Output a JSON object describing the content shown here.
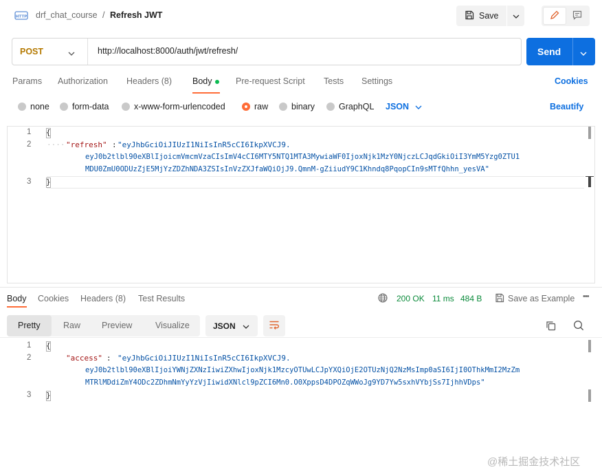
{
  "breadcrumb": {
    "collection": "drf_chat_course",
    "separator": "/",
    "title": "Refresh JWT"
  },
  "toolbar": {
    "save_label": "Save"
  },
  "request": {
    "method": "POST",
    "url": "http://localhost:8000/auth/jwt/refresh/",
    "send_label": "Send",
    "method_color": "#b47900"
  },
  "request_tabs": [
    {
      "label": "Params"
    },
    {
      "label": "Authorization"
    },
    {
      "label": "Headers (8)"
    },
    {
      "label": "Body",
      "active": true
    },
    {
      "label": "Pre-request Script"
    },
    {
      "label": "Tests"
    },
    {
      "label": "Settings"
    }
  ],
  "cookies_label": "Cookies",
  "body_types": [
    {
      "label": "none"
    },
    {
      "label": "form-data"
    },
    {
      "label": "x-www-form-urlencoded"
    },
    {
      "label": "raw",
      "selected": true
    },
    {
      "label": "binary"
    },
    {
      "label": "GraphQL"
    }
  ],
  "body_format": "JSON",
  "beautify_label": "Beautify",
  "request_body": {
    "line_numbers": [
      "1",
      "2",
      "3"
    ],
    "open_brace": "{",
    "close_brace": "}",
    "indent_dots": "····",
    "key": "\"refresh\"",
    "colon": ":",
    "value_lines": [
      "\"eyJhbGciOiJIUzI1NiIsInR5cCI6IkpXVCJ9.",
      "eyJ0b2tlbl90eXBlIjoicmVmcmVzaCIsImV4cCI6MTY5NTQ1MTA3MywiaWF0IjoxNjk1MzY0NjczLCJqdGkiOiI3YmM5Yzg0ZTU1",
      "MDU0ZmU0ODUzZjE5MjYzZDZhNDA3ZSIsInVzZXJfaWQiOjJ9.QmnM-gZiiudY9C1Khndq8PqopCIn9sMTfQhhn_yesVA\""
    ]
  },
  "response_tabs": [
    {
      "label": "Body",
      "active": true
    },
    {
      "label": "Cookies"
    },
    {
      "label": "Headers (8)"
    },
    {
      "label": "Test Results"
    }
  ],
  "response_status": {
    "code": "200 OK",
    "time": "11 ms",
    "size": "484 B",
    "color": "#0a8a3a"
  },
  "save_example_label": "Save as Example",
  "more_label": "•••",
  "response_formats": [
    {
      "label": "Pretty",
      "active": true
    },
    {
      "label": "Raw"
    },
    {
      "label": "Preview"
    },
    {
      "label": "Visualize"
    }
  ],
  "response_format": "JSON",
  "response_body": {
    "line_numbers": [
      "1",
      "2",
      "3"
    ],
    "open_brace": "{",
    "close_brace": "}",
    "key": "\"access\"",
    "colon": ": ",
    "value_lines": [
      "\"eyJhbGciOiJIUzI1NiIsInR5cCI6IkpXVCJ9.",
      "eyJ0b2tlbl90eXBlIjoiYWNjZXNzIiwiZXhwIjoxNjk1MzcyOTUwLCJpYXQiOjE2OTUzNjQ2NzMsImp0aSI6IjI0OThkMmI2MzZm",
      "MTRlMDdiZmY4ODc2ZDhmNmYyYzVjIiwidXNlcl9pZCI6Mn0.O0XppsD4DPOZqWWoJg9YD7Yw5sxhVYbjSs7IjhhVDps\""
    ]
  },
  "watermark": "@稀土掘金技术社区",
  "colors": {
    "accent": "#ff6c37",
    "primary": "#0d6fe0",
    "key": "#a31515",
    "string": "#0451a5"
  }
}
